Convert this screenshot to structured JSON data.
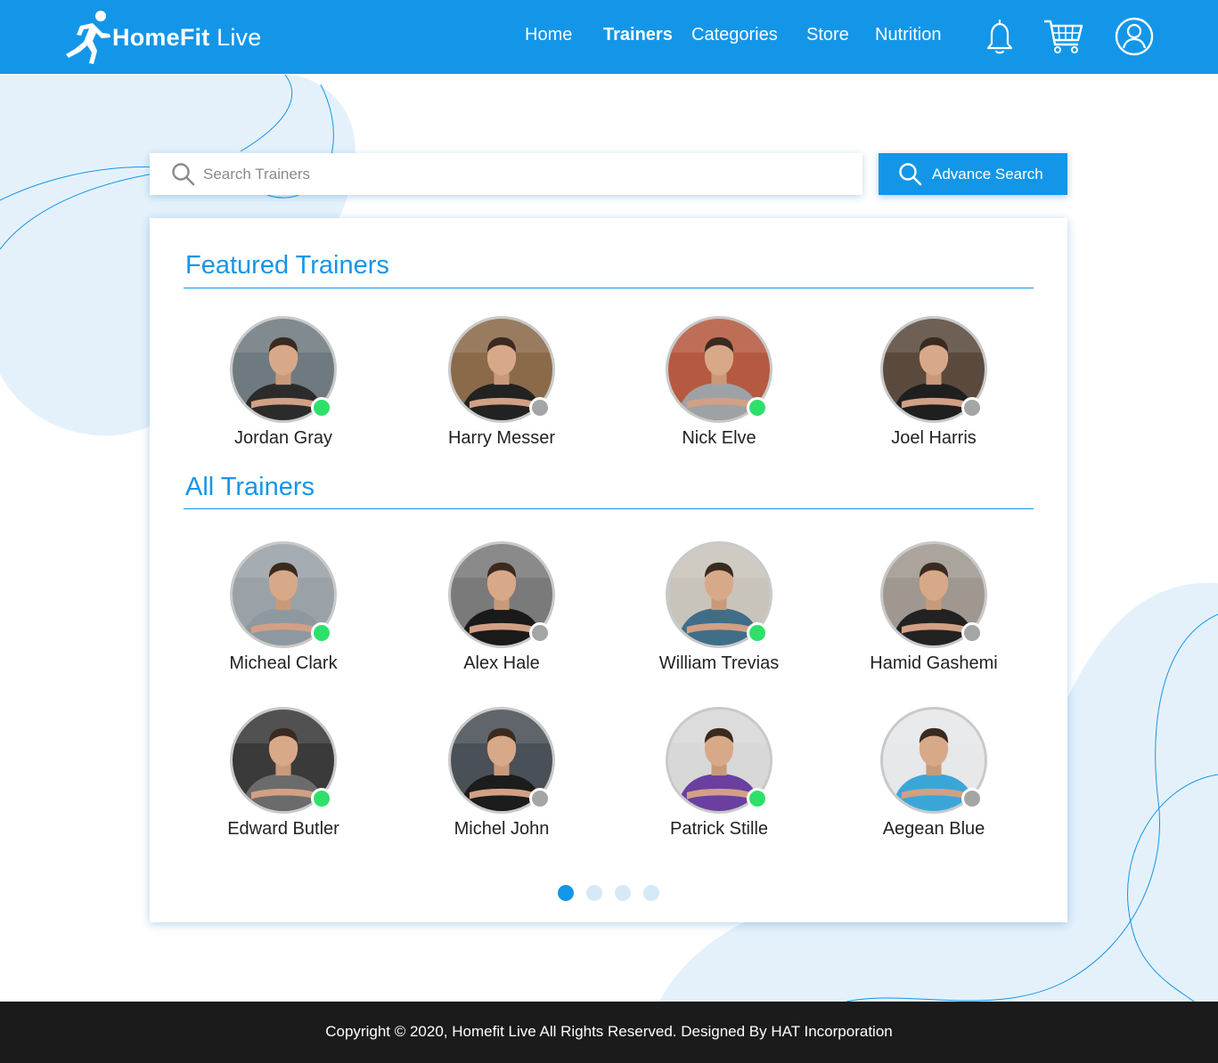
{
  "brand": {
    "name_bold": "HomeFit",
    "name_light": "Live"
  },
  "nav": {
    "items": [
      {
        "label": "Home",
        "active": false
      },
      {
        "label": "Trainers",
        "active": true
      },
      {
        "label": "Categories",
        "active": false
      },
      {
        "label": "Store",
        "active": false
      },
      {
        "label": "Nutrition",
        "active": false
      }
    ],
    "icons": [
      "bell-icon",
      "cart-icon",
      "user-icon"
    ]
  },
  "search": {
    "placeholder": "Search Trainers",
    "value": ""
  },
  "advanced_search": {
    "label": "Advance Search"
  },
  "featured": {
    "title": "Featured Trainers",
    "trainers": [
      {
        "name": "Jordan Gray",
        "online": true,
        "shirt": "#2b2b2b",
        "bg": "#6f7a80"
      },
      {
        "name": "Harry Messer",
        "online": false,
        "shirt": "#222222",
        "bg": "#8b6a4a"
      },
      {
        "name": "Nick Elve",
        "online": true,
        "shirt": "#9ea2a6",
        "bg": "#b55a40"
      },
      {
        "name": "Joel Harris",
        "online": false,
        "shirt": "#1f1f1f",
        "bg": "#5a4a3e"
      }
    ]
  },
  "all": {
    "title": "All Trainers",
    "trainers": [
      {
        "name": "Micheal Clark",
        "online": true,
        "shirt": "#8e98a0",
        "bg": "#9aa2a8"
      },
      {
        "name": "Alex Hale",
        "online": false,
        "shirt": "#1a1a1a",
        "bg": "#7a7a7a"
      },
      {
        "name": "William Trevias",
        "online": true,
        "shirt": "#3f6e88",
        "bg": "#c9c4bb"
      },
      {
        "name": "Hamid Gashemi",
        "online": false,
        "shirt": "#222222",
        "bg": "#a09890"
      },
      {
        "name": "Edward Butler",
        "online": true,
        "shirt": "#6b6b6b",
        "bg": "#3a3a3a"
      },
      {
        "name": "Michel John",
        "online": false,
        "shirt": "#1c1c1c",
        "bg": "#4a5058"
      },
      {
        "name": "Patrick Stille",
        "online": true,
        "shirt": "#6a3fa0",
        "bg": "#d8d8d8"
      },
      {
        "name": "Aegean Blue",
        "online": false,
        "shirt": "#3aa6d8",
        "bg": "#e6e8ea"
      }
    ]
  },
  "pagination": {
    "pages": 4,
    "current": 1
  },
  "colors": {
    "primary": "#1496e8",
    "online": "#2ee06a",
    "offline": "#a5a5a5",
    "footer": "#1b1b1b"
  },
  "footer": {
    "text": "Copyright © 2020, Homefit Live All Rights Reserved. Designed By HAT Incorporation"
  }
}
